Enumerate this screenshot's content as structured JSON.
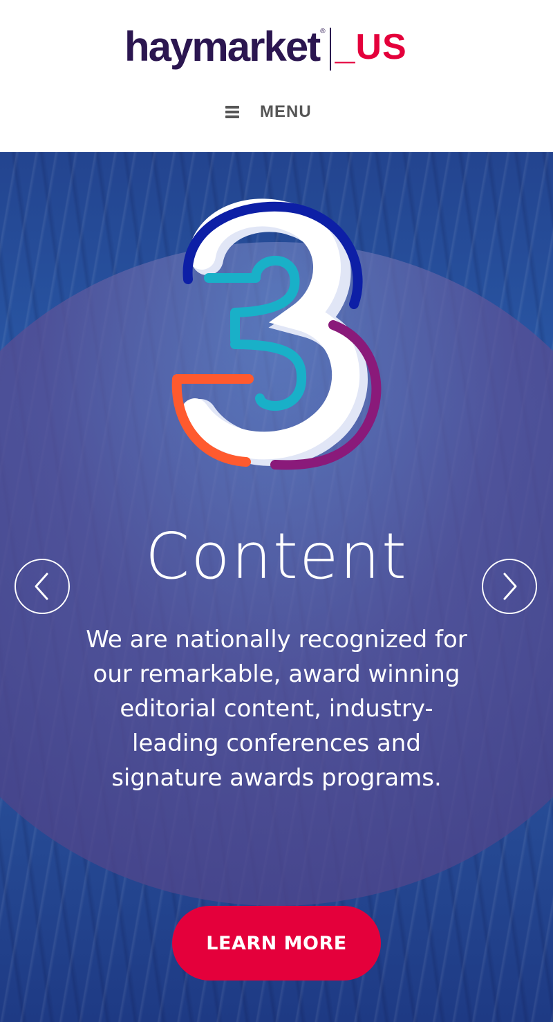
{
  "header": {
    "logo": {
      "wordmark": "haymarket",
      "registered": "®",
      "region": "_US"
    },
    "menu": {
      "icon": "hamburger-icon",
      "label": "MENU"
    }
  },
  "hero": {
    "graphic": {
      "digit": "3",
      "colors": {
        "top_arc": "#0d1fa6",
        "middle": "#19b0c8",
        "bottom_left": "#ff5a2e",
        "right_arc": "#8a1a7a"
      }
    },
    "title": "Content",
    "body": "We are nationally recognized for our remarkable, award winning editorial content, industry-leading conferences and signature awards programs.",
    "prev_icon": "chevron-left-icon",
    "next_icon": "chevron-right-icon",
    "cta_label": "LEARN MORE"
  },
  "colors": {
    "brand_purple": "#2b1650",
    "brand_red": "#e4003b",
    "hero_blue": "#2a5aa8"
  }
}
